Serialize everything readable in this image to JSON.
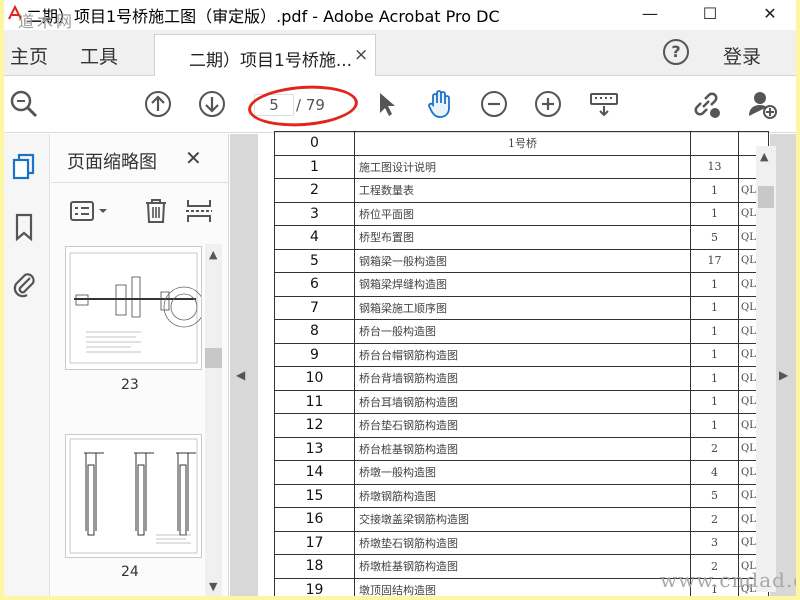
{
  "window": {
    "title": "二期）项目1号桥施工图（审定版）.pdf - Adobe Acrobat Pro DC",
    "minimize_glyph": "—",
    "maximize_glyph": "☐",
    "close_glyph": "✕"
  },
  "menu": {
    "home": "主页",
    "tools": "工具",
    "doc_tab": "二期）项目1号桥施...",
    "doc_tab_close": "×",
    "help": "?",
    "login": "登录"
  },
  "toolbar": {
    "page_current": "5",
    "page_total": "/ 79",
    "highlight_color": "#e0261d",
    "icons": [
      "zoom-search-icon",
      "page-up-icon",
      "page-down-icon",
      "select-pointer-icon",
      "hand-tool-icon",
      "zoom-out-icon",
      "zoom-in-icon",
      "keyboard-scroll-icon",
      "share-link-icon",
      "add-user-icon"
    ]
  },
  "thumbnails": {
    "title": "页面缩略图",
    "close": "✕",
    "pages": [
      {
        "label": "23"
      },
      {
        "label": "24"
      }
    ]
  },
  "document": {
    "header": {
      "no": "0",
      "name": "1号桥"
    },
    "rows": [
      {
        "no": "1",
        "name": "施工图设计说明",
        "count": "13",
        "code": ""
      },
      {
        "no": "2",
        "name": "工程数量表",
        "count": "1",
        "code": "QL-"
      },
      {
        "no": "3",
        "name": "桥位平面图",
        "count": "1",
        "code": "QL-"
      },
      {
        "no": "4",
        "name": "桥型布置图",
        "count": "5",
        "code": "QL-"
      },
      {
        "no": "5",
        "name": "钢箱梁一般构造图",
        "count": "17",
        "code": "QL-"
      },
      {
        "no": "6",
        "name": "钢箱梁焊缝构造图",
        "count": "1",
        "code": "QL-"
      },
      {
        "no": "7",
        "name": "钢箱梁施工顺序图",
        "count": "1",
        "code": "QL-"
      },
      {
        "no": "8",
        "name": "桥台一般构造图",
        "count": "1",
        "code": "QL-"
      },
      {
        "no": "9",
        "name": "桥台台帽钢筋构造图",
        "count": "1",
        "code": "QL-"
      },
      {
        "no": "10",
        "name": "桥台背墙钢筋构造图",
        "count": "1",
        "code": "QL-"
      },
      {
        "no": "11",
        "name": "桥台耳墙钢筋构造图",
        "count": "1",
        "code": "QL-"
      },
      {
        "no": "12",
        "name": "桥台垫石钢筋构造图",
        "count": "1",
        "code": "QL-"
      },
      {
        "no": "13",
        "name": "桥台桩基钢筋构造图",
        "count": "2",
        "code": "QL-"
      },
      {
        "no": "14",
        "name": "桥墩一般构造图",
        "count": "4",
        "code": "QL-"
      },
      {
        "no": "15",
        "name": "桥墩钢筋构造图",
        "count": "5",
        "code": "QL-"
      },
      {
        "no": "16",
        "name": "交接墩盖梁钢筋构造图",
        "count": "2",
        "code": "QL-"
      },
      {
        "no": "17",
        "name": "桥墩垫石钢筋构造图",
        "count": "3",
        "code": "QL-"
      },
      {
        "no": "18",
        "name": "桥墩桩基钢筋构造图",
        "count": "2",
        "code": "QL-"
      },
      {
        "no": "19",
        "name": "墩顶固结构造图",
        "count": "1",
        "code": "QL-"
      }
    ]
  },
  "watermarks": {
    "bottom_right": "www.cndad.com",
    "top_left": "道木网"
  }
}
